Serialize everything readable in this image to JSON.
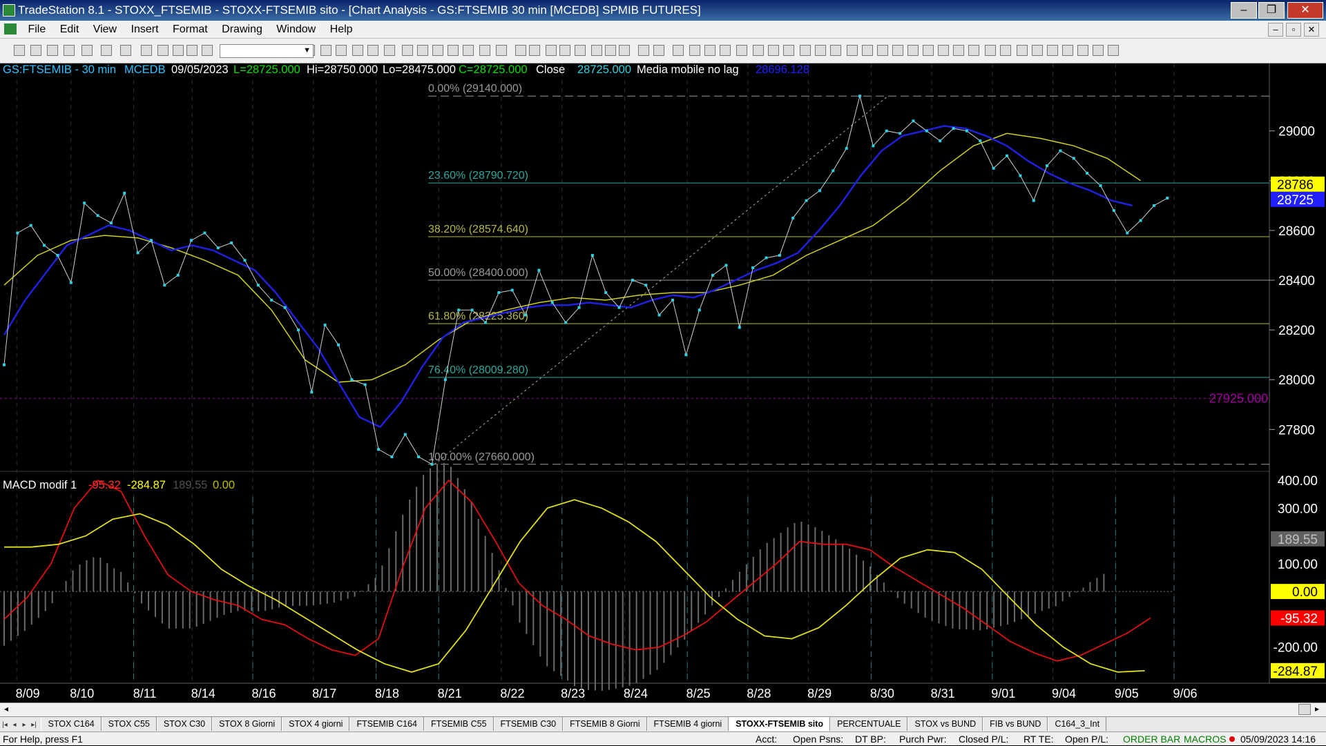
{
  "window": {
    "title": "TradeStation 8.1 - STOXX_FTSEMIB - STOXX-FTSEMIB sito - [Chart Analysis - GS:FTSEMIB  30 min  [MCEDB] SPMIB FUTURES]",
    "minimize": "‒",
    "maximize": "❐",
    "close": "✕"
  },
  "menu": [
    "File",
    "Edit",
    "View",
    "Insert",
    "Format",
    "Drawing",
    "Window",
    "Help"
  ],
  "chart_data": {
    "type": "line",
    "header": {
      "symbol": "GS:FTSEMIB - 30 min",
      "exchange": "MCEDB",
      "date": "09/05/2023",
      "low_label": "L=28725.000",
      "high": "Hi=28750.000",
      "lo": "Lo=28475.000",
      "close_label": "C=28725.000",
      "close_word": "Close",
      "close_value": "28725.000",
      "ma_name": "Media mobile no lag",
      "ma_value": "28696.128"
    },
    "x_ticks": [
      "8/09",
      "8/10",
      "8/11",
      "8/14",
      "8/16",
      "8/17",
      "8/18",
      "8/21",
      "8/22",
      "8/23",
      "8/24",
      "8/25",
      "8/28",
      "8/29",
      "8/30",
      "8/31",
      "9/01",
      "9/04",
      "9/05",
      "9/06"
    ],
    "price_axis": {
      "ticks": [
        "29000",
        "28800",
        "28600",
        "28400",
        "28200",
        "28000",
        "27800"
      ],
      "ylim": [
        27640,
        29210
      ]
    },
    "price_labels": [
      {
        "text": "28786",
        "value": 28786,
        "bg": "#ffff00",
        "fg": "#000000"
      },
      {
        "text": "28725",
        "value": 28725,
        "bg": "#2020ff",
        "fg": "#ffffff"
      }
    ],
    "hline": {
      "text": "27925.000",
      "value": 27925,
      "color": "#a000a0"
    },
    "fib_levels": [
      {
        "label": "0.00% (29140.000)",
        "value": 29140,
        "color": "#9a9a9a",
        "dashed": true
      },
      {
        "label": "23.60% (28790.720)",
        "value": 28790.72,
        "color": "#2ea89c"
      },
      {
        "label": "38.20% (28574.640)",
        "value": 28574.64,
        "color": "#b8b84a"
      },
      {
        "label": "50.00% (28400.000)",
        "value": 28400,
        "color": "#9a9a9a"
      },
      {
        "label": "61.80% (28225.360)",
        "value": 28225.36,
        "color": "#b8b84a"
      },
      {
        "label": "76.40% (28009.280)",
        "value": 28009.28,
        "color": "#2ea89c"
      },
      {
        "label": "100.00% (27660.000)",
        "value": 27660,
        "color": "#9a9a9a",
        "dashed": true
      }
    ],
    "fib_anchor": {
      "from": {
        "t": 20.6,
        "v": 27660
      },
      "to": {
        "t": 42.3,
        "v": 29140
      }
    },
    "price_t": [
      0,
      0.5,
      1,
      1.5,
      2,
      2.5,
      3,
      3.5,
      4,
      4.5,
      5,
      5.5,
      6,
      6.5,
      7,
      7.5,
      8,
      8.5,
      9,
      9.5,
      10,
      10.5,
      11,
      11.5,
      12,
      12.5,
      13,
      13.5,
      14,
      14.5,
      15,
      15.5,
      16,
      16.5,
      17,
      17.5,
      18,
      18.5,
      19,
      19.5,
      20,
      20.5,
      21,
      21.5,
      22,
      22.5,
      23,
      23.5,
      24,
      24.5,
      25,
      25.5,
      26,
      26.5,
      27,
      27.5,
      28,
      28.5,
      29,
      29.5,
      30,
      30.5,
      31,
      31.5,
      32,
      32.5,
      33,
      33.5,
      34,
      34.5,
      35,
      35.5,
      36,
      36.5,
      37,
      37.5,
      38,
      38.5,
      39,
      39.5,
      40,
      40.5,
      41,
      41.5,
      42,
      42.5,
      43,
      43.5,
      44,
      44.5,
      45,
      45.5,
      46,
      46.5,
      47,
      47.5,
      48,
      48.5,
      49,
      49.5,
      50,
      50.5,
      51,
      51.5,
      52,
      52.5,
      53,
      53.5,
      54,
      54.5,
      55,
      55.5
    ],
    "price": [
      28060,
      28590,
      28620,
      28540,
      28500,
      28390,
      28710,
      28660,
      28630,
      28750,
      28510,
      28560,
      28380,
      28420,
      28560,
      28590,
      28530,
      28550,
      28480,
      28380,
      28320,
      28290,
      28200,
      27950,
      28220,
      28140,
      28000,
      27980,
      27720,
      27690,
      27780,
      27690,
      27660,
      28000,
      28280,
      28280,
      28230,
      28350,
      28360,
      28260,
      28440,
      28310,
      28230,
      28290,
      28500,
      28350,
      28290,
      28400,
      28380,
      28260,
      28320,
      28100,
      28280,
      28420,
      28460,
      28210,
      28450,
      28490,
      28500,
      28650,
      28720,
      28760,
      28840,
      28930,
      29140,
      28940,
      29000,
      28990,
      29040,
      29000,
      28960,
      29010,
      29000,
      28960,
      28850,
      28900,
      28820,
      28720,
      28860,
      28920,
      28890,
      28830,
      28780,
      28680,
      28590,
      28640,
      28700,
      28730
    ],
    "blue_ma": [
      28180,
      28320,
      28430,
      28540,
      28580,
      28620,
      28600,
      28560,
      28520,
      28540,
      28520,
      28480,
      28440,
      28350,
      28240,
      28130,
      27990,
      27850,
      27810,
      27910,
      28050,
      28170,
      28230,
      28250,
      28270,
      28290,
      28300,
      28300,
      28310,
      28300,
      28290,
      28320,
      28340,
      28330,
      28360,
      28400,
      28440,
      28470,
      28510,
      28600,
      28700,
      28820,
      28920,
      28980,
      29000,
      29020,
      29010,
      28980,
      28940,
      28880,
      28830,
      28790,
      28760,
      28720,
      28700
    ],
    "yellow_ma": [
      28380,
      28500,
      28560,
      28580,
      28570,
      28530,
      28480,
      28420,
      28280,
      28080,
      27990,
      28000,
      28060,
      28160,
      28240,
      28280,
      28310,
      28330,
      28320,
      28340,
      28350,
      28350,
      28380,
      28420,
      28500,
      28560,
      28620,
      28720,
      28840,
      28940,
      28990,
      28970,
      28940,
      28890,
      28800
    ],
    "ma_t_step_blue": 1.0,
    "ma_t_step_yellow": 1.6,
    "macd": {
      "title": "MACD modif 1",
      "v1": "-95.32",
      "v2": "-284.87",
      "v3": "189.55",
      "v4": "0.00",
      "ticks": [
        "400.00",
        "300.00",
        "100.00",
        "-200.00"
      ],
      "ylim": [
        -330,
        420
      ],
      "badges": [
        {
          "text": "189.55",
          "value": 189.55,
          "bg": "#606060",
          "fg": "#c0c0c0"
        },
        {
          "text": "0.00",
          "value": 0,
          "bg": "#ffff00",
          "fg": "#000000"
        },
        {
          "text": "-95.32",
          "value": -95.32,
          "bg": "#ff0000",
          "fg": "#ffffff"
        },
        {
          "text": "-284.87",
          "value": -284.87,
          "bg": "#ffff00",
          "fg": "#000000"
        }
      ],
      "red": [
        -100,
        -20,
        100,
        300,
        400,
        360,
        200,
        60,
        0,
        -30,
        -50,
        -100,
        -120,
        -170,
        -210,
        -230,
        -170,
        80,
        300,
        400,
        320,
        180,
        30,
        -50,
        -100,
        -160,
        -190,
        -210,
        -200,
        -160,
        -110,
        -40,
        30,
        100,
        180,
        170,
        170,
        150,
        90,
        40,
        -10,
        -60,
        -120,
        -180,
        -220,
        -250,
        -230,
        -190,
        -150,
        -95
      ],
      "yellow": [
        160,
        160,
        170,
        200,
        260,
        280,
        240,
        170,
        80,
        20,
        -30,
        -90,
        -150,
        -210,
        -260,
        -290,
        -260,
        -140,
        20,
        180,
        300,
        330,
        300,
        250,
        180,
        80,
        -20,
        -100,
        -160,
        -170,
        -130,
        -50,
        40,
        120,
        150,
        140,
        80,
        -20,
        -120,
        -200,
        -260,
        -290,
        -285
      ],
      "yellow_step": 1.3
    }
  },
  "tabs": [
    "STOX C164",
    "STOX C55",
    "STOX  C30",
    "STOX  8 Giorni",
    "STOX 4 giorni",
    "FTSEMIB C164",
    "FTSEMIB C55",
    "FTSEMIB C30",
    "FTSEMIB  8 Giorni",
    "FTSEMIB  4 giorni",
    "STOXX-FTSEMIB sito",
    "PERCENTUALE",
    "STOX vs BUND",
    "FIB vs BUND",
    "C164_3_Int"
  ],
  "active_tab": "STOXX-FTSEMIB sito",
  "status": {
    "help": "For Help, press F1",
    "acct": "Acct:",
    "open_psns": "Open Psns:",
    "dt_bp": "DT BP:",
    "purch_pwr": "Purch Pwr:",
    "closed_pl": "Closed P/L:",
    "rt_te": "RT TE:",
    "open_pl": "Open P/L:",
    "order_bar": "ORDER BAR",
    "macros": "MACROS",
    "datetime": "05/09/2023 14:16"
  },
  "colors": {
    "bg": "#000000",
    "price": "#30d0e0",
    "blue_ma": "#2020e0",
    "yellow": "#d0d020",
    "macd_red": "#e01010",
    "macd_yellow": "#e0e020"
  }
}
